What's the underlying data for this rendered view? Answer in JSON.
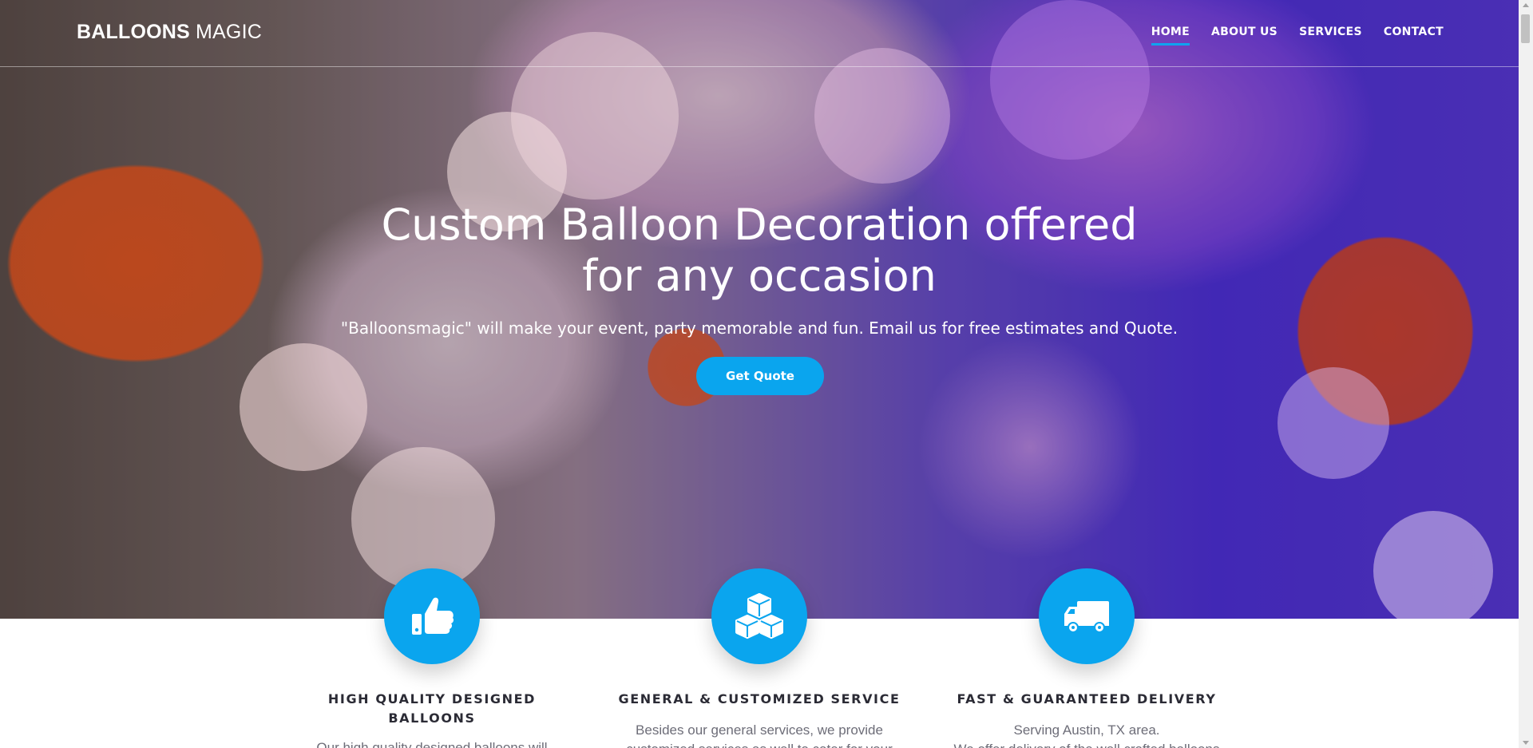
{
  "brand": {
    "bold": "BALLOONS",
    "light": " MAGIC"
  },
  "nav": {
    "items": [
      {
        "label": "HOME",
        "active": true
      },
      {
        "label": "ABOUT US",
        "active": false
      },
      {
        "label": "SERVICES",
        "active": false
      },
      {
        "label": "CONTACT",
        "active": false
      }
    ]
  },
  "hero": {
    "title": "Custom Balloon Decoration offered for any occasion",
    "subtitle": "\"Balloonsmagic\" will make your event, party memorable and fun. Email us for free estimates and Quote.",
    "button_label": "Get Quote"
  },
  "features": [
    {
      "icon": "thumbs-up-icon",
      "title": "HIGH QUALITY DESIGNED BALLOONS",
      "text": "Our high quality designed balloons will"
    },
    {
      "icon": "cubes-icon",
      "title": "GENERAL & CUSTOMIZED SERVICE",
      "text": "Besides our general services, we provide",
      "text2": "customized services as well to cater for your"
    },
    {
      "icon": "truck-icon",
      "title": "FAST & GUARANTEED DELIVERY",
      "text": "Serving Austin, TX area.",
      "text2": "We offer delivery of the well crafted balloons"
    }
  ],
  "colors": {
    "accent": "#0aa5ee",
    "heading": "#2b2b35",
    "body_text": "#6d6d78"
  }
}
